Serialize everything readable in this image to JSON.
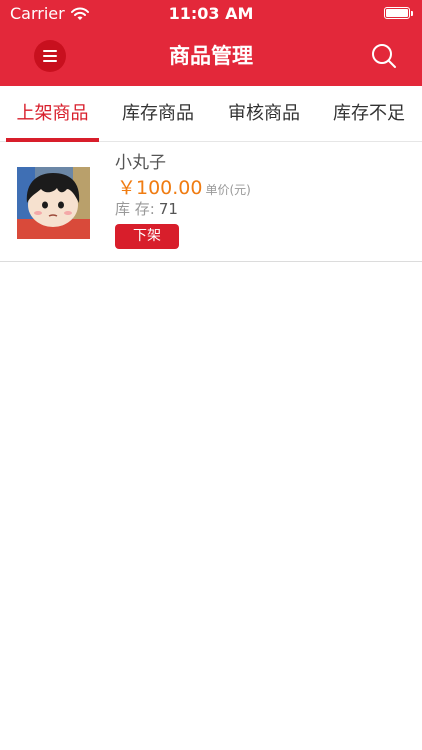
{
  "status_bar": {
    "carrier": "Carrier",
    "time": "11:03 AM",
    "wifi_icon": "wifi-icon",
    "battery_icon": "battery-icon"
  },
  "nav": {
    "title": "商品管理",
    "menu_icon": "menu-icon",
    "search_icon": "search-icon"
  },
  "tabs": [
    {
      "label": "上架商品",
      "active": true
    },
    {
      "label": "库存商品",
      "active": false
    },
    {
      "label": "审核商品",
      "active": false
    },
    {
      "label": "库存不足",
      "active": false
    }
  ],
  "products": [
    {
      "name": "小丸子",
      "price": "￥100.00",
      "unit": "单价(元)",
      "stock_label": "库 存:",
      "stock_value": "71",
      "action_label": "下架"
    }
  ],
  "colors": {
    "brand_red": "#e3283a",
    "accent_red": "#d81e2b",
    "price_orange": "#f07c12"
  }
}
